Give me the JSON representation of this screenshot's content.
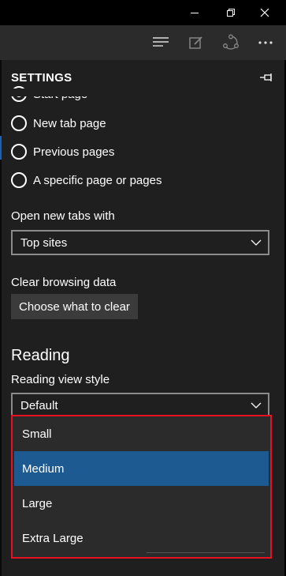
{
  "window_controls": {
    "minimize_icon": "minimize-icon",
    "restore_icon": "restore-icon",
    "close_icon": "close-icon"
  },
  "toolbar": {
    "icons": [
      "hub-icon",
      "web-note-icon",
      "share-icon",
      "more-icon"
    ]
  },
  "settings": {
    "title": "SETTINGS",
    "pin_icon": "pin-icon",
    "startup": {
      "options": [
        {
          "label": "Start page",
          "checked": true
        },
        {
          "label": "New tab page",
          "checked": false
        },
        {
          "label": "Previous pages",
          "checked": false
        },
        {
          "label": "A specific page or pages",
          "checked": false
        }
      ]
    },
    "new_tabs": {
      "label": "Open new tabs with",
      "value": "Top sites"
    },
    "clear_data": {
      "label": "Clear browsing data",
      "button": "Choose what to clear"
    },
    "reading": {
      "heading": "Reading",
      "style_label": "Reading view style",
      "style_value": "Default",
      "style_options": [
        "Small",
        "Medium",
        "Large",
        "Extra Large"
      ],
      "style_selected": "Medium"
    }
  },
  "colors": {
    "accent": "#1e5a92",
    "highlight_border": "#e81123",
    "panel_bg": "#1f1f1f",
    "toolbar_bg": "#2b2b2b"
  }
}
